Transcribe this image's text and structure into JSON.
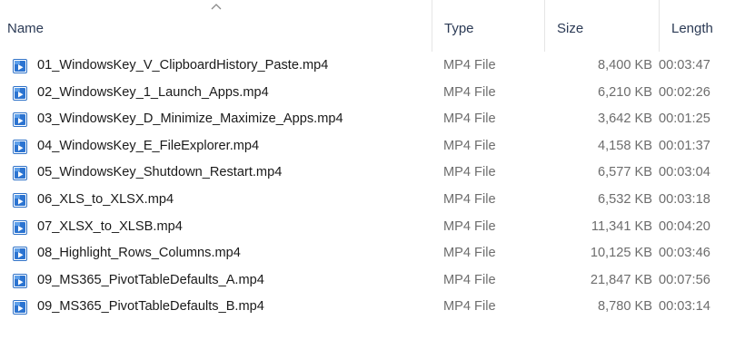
{
  "header": {
    "name_label": "Name",
    "type_label": "Type",
    "size_label": "Size",
    "length_label": "Length",
    "sort_indicator": "chevron-up-icon"
  },
  "files": [
    {
      "name": "01_WindowsKey_V_ClipboardHistory_Paste.mp4",
      "type": "MP4 File",
      "size": "8,400 KB",
      "length": "00:03:47",
      "icon": "video-file-icon"
    },
    {
      "name": "02_WindowsKey_1_Launch_Apps.mp4",
      "type": "MP4 File",
      "size": "6,210 KB",
      "length": "00:02:26",
      "icon": "video-file-icon"
    },
    {
      "name": "03_WindowsKey_D_Minimize_Maximize_Apps.mp4",
      "type": "MP4 File",
      "size": "3,642 KB",
      "length": "00:01:25",
      "icon": "video-file-icon"
    },
    {
      "name": "04_WindowsKey_E_FileExplorer.mp4",
      "type": "MP4 File",
      "size": "4,158 KB",
      "length": "00:01:37",
      "icon": "video-file-icon"
    },
    {
      "name": "05_WindowsKey_Shutdown_Restart.mp4",
      "type": "MP4 File",
      "size": "6,577 KB",
      "length": "00:03:04",
      "icon": "video-file-icon"
    },
    {
      "name": "06_XLS_to_XLSX.mp4",
      "type": "MP4 File",
      "size": "6,532 KB",
      "length": "00:03:18",
      "icon": "video-file-icon"
    },
    {
      "name": "07_XLSX_to_XLSB.mp4",
      "type": "MP4 File",
      "size": "11,341 KB",
      "length": "00:04:20",
      "icon": "video-file-icon"
    },
    {
      "name": "08_Highlight_Rows_Columns.mp4",
      "type": "MP4 File",
      "size": "10,125 KB",
      "length": "00:03:46",
      "icon": "video-file-icon"
    },
    {
      "name": "09_MS365_PivotTableDefaults_A.mp4",
      "type": "MP4 File",
      "size": "21,847 KB",
      "length": "00:07:56",
      "icon": "video-file-icon"
    },
    {
      "name": "09_MS365_PivotTableDefaults_B.mp4",
      "type": "MP4 File",
      "size": "8,780 KB",
      "length": "00:03:14",
      "icon": "video-file-icon"
    }
  ]
}
